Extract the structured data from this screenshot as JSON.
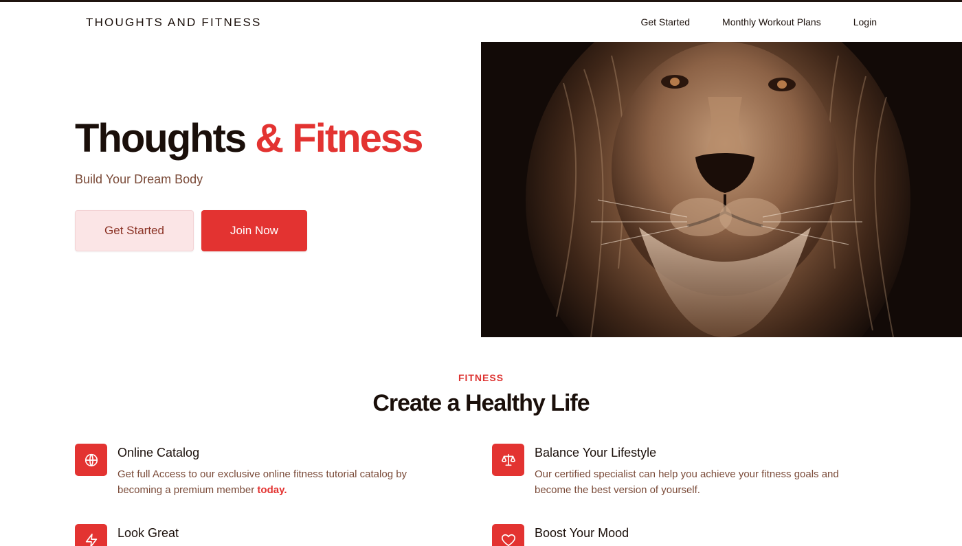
{
  "nav": {
    "brand": "THOUGHTS AND FITNESS",
    "links": [
      "Get Started",
      "Monthly Workout Plans",
      "Login"
    ]
  },
  "hero": {
    "title_part1": "Thoughts",
    "title_part2": "& Fitness",
    "subtitle": "Build Your Dream Body",
    "btn_get_started": "Get Started",
    "btn_join_now": "Join Now",
    "image_icon": "lion-portrait-image"
  },
  "section": {
    "tag": "FITNESS",
    "title": "Create a Healthy Life"
  },
  "features": [
    {
      "icon": "globe-icon",
      "title": "Online Catalog",
      "desc_before": "Get full Access to our exclusive online fitness tutorial catalog by becoming a premium member ",
      "desc_highlight": "today."
    },
    {
      "icon": "scale-icon",
      "title": "Balance Your Lifestyle",
      "desc_before": "Our certified specialist can help you achieve your fitness goals and become the best version of yourself.",
      "desc_highlight": ""
    },
    {
      "icon": "lightning-icon",
      "title": "Look Great",
      "desc_before": "",
      "desc_highlight": ""
    },
    {
      "icon": "heart-icon",
      "title": "Boost Your Mood",
      "desc_before": "",
      "desc_highlight": ""
    }
  ],
  "colors": {
    "accent": "#e33331",
    "text_dark": "#1a0f0a",
    "text_muted": "#7a4a38",
    "soft_button_bg": "#fbe5e6"
  }
}
